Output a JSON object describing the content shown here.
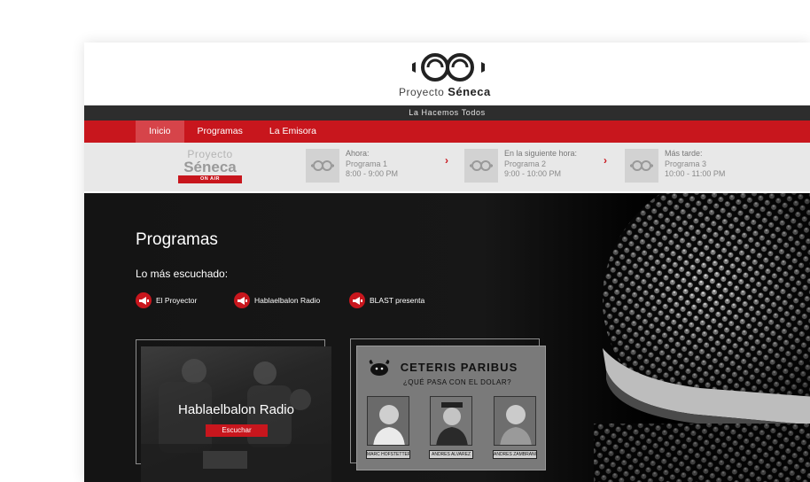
{
  "brand": {
    "name_light": "Proyecto",
    "name_bold": "Séneca"
  },
  "tagline": "La Hacemos Todos",
  "nav": {
    "items": [
      {
        "label": "Inicio"
      },
      {
        "label": "Programas"
      },
      {
        "label": "La Emisora"
      }
    ]
  },
  "onair": {
    "logo_line1": "Proyecto",
    "logo_line2": "Séneca",
    "badge": "ON AIR",
    "slots": [
      {
        "label": "Ahora:",
        "program": "Programa 1",
        "time": "8:00 - 9:00 PM"
      },
      {
        "label": "En la siguiente hora:",
        "program": "Programa 2",
        "time": "9:00 - 10:00 PM"
      },
      {
        "label": "Más tarde:",
        "program": "Programa 3",
        "time": "10:00 - 11:00 PM"
      }
    ]
  },
  "main": {
    "title": "Programas",
    "popular_title": "Lo más escuchado:",
    "popular": [
      {
        "label": "El Proyector"
      },
      {
        "label": "Hablaelbalon Radio"
      },
      {
        "label": "BLAST presenta"
      }
    ],
    "cards": [
      {
        "title": "Hablaelbalon Radio",
        "button": "Escuchar"
      },
      {
        "title": "CETERIS PARIBUS",
        "subtitle": "¿QUÉ PASA CON EL DOLAR?",
        "people": [
          "MARC HOFSTETTER",
          "ANDRES ALVAREZ",
          "ANDRES ZAMBRANO"
        ]
      }
    ]
  },
  "colors": {
    "accent": "#c8161d",
    "dark": "#2d2d2d",
    "onair_bg": "#e8e8e8"
  }
}
